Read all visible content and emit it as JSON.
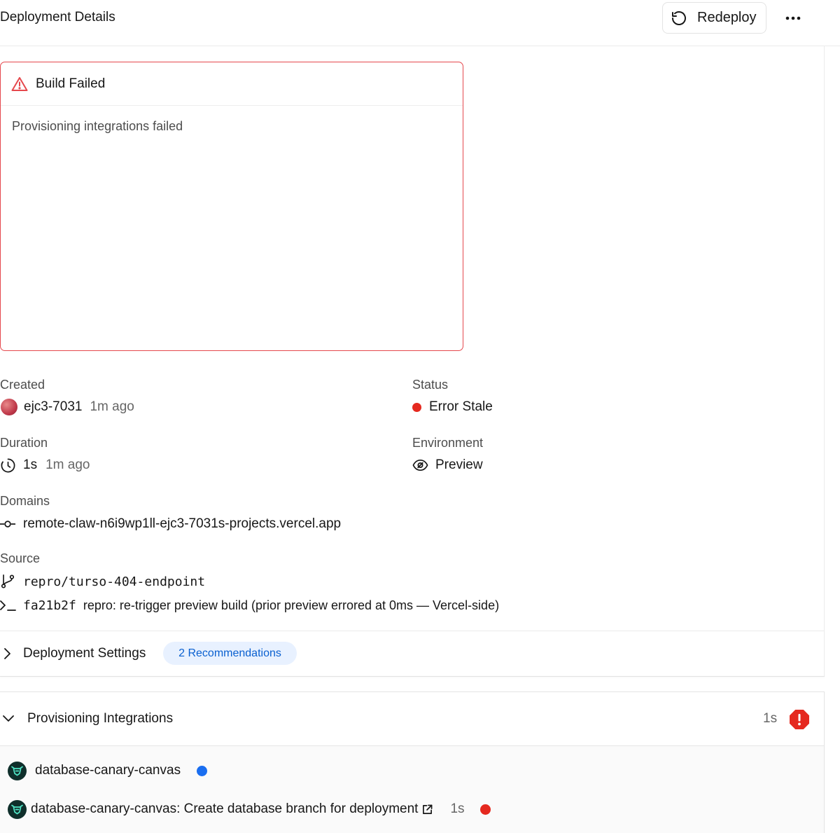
{
  "header": {
    "title": "Deployment Details",
    "redeploy_label": "Redeploy",
    "redeploy_icon": "rotate-ccw-icon",
    "more_icon": "ellipsis-icon"
  },
  "error": {
    "icon": "warning-triangle-icon",
    "title": "Build Failed",
    "message": "Provisioning integrations failed",
    "color": "#e5484d"
  },
  "meta": {
    "created": {
      "label": "Created",
      "user": "ejc3-7031",
      "time": "1m ago"
    },
    "status": {
      "label": "Status",
      "value": "Error Stale",
      "color": "#e5291f"
    },
    "duration": {
      "label": "Duration",
      "value": "1s",
      "time": "1m ago"
    },
    "environment": {
      "label": "Environment",
      "value": "Preview",
      "icon": "eye-icon"
    },
    "domains": {
      "label": "Domains",
      "value": "remote-claw-n6i9wp1ll-ejc3-7031s-projects.vercel.app"
    },
    "source": {
      "label": "Source",
      "branch": "repro/turso-404-endpoint",
      "commit_sha": "fa21b2f",
      "commit_message": "repro: re-trigger preview build (prior preview errored at 0ms — Vercel-side)"
    }
  },
  "settings": {
    "label": "Deployment Settings",
    "badge": "2 Recommendations"
  },
  "provisioning": {
    "title": "Provisioning Integrations",
    "duration": "1s",
    "error_color": "#e5291f",
    "items": [
      {
        "name": "database-canary-canvas",
        "status_color": "#1a6ef0"
      },
      {
        "name": "database-canary-canvas: Create database branch for deployment",
        "duration": "1s",
        "status_color": "#e5291f"
      }
    ]
  }
}
